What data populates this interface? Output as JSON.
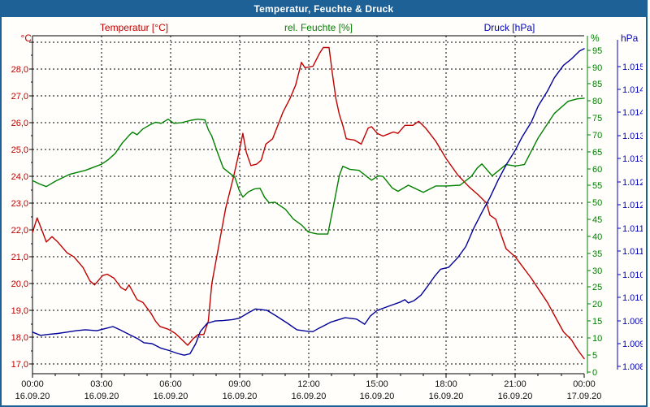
{
  "window": {
    "title": "Temperatur, Feuchte & Druck",
    "title_bar_color": "#1d6197",
    "border_color": "#1d6197",
    "background": "#fffefa"
  },
  "legend": {
    "temperature": "Temperatur [°C]",
    "humidity": "rel. Feuchte [%]",
    "pressure": "Druck [hPa]"
  },
  "chart_data": {
    "type": "line",
    "title": "Temperatur, Feuchte & Druck",
    "grid": true,
    "axes": {
      "x": {
        "min": 0,
        "max": 24,
        "grid_hours": [
          3,
          6,
          9,
          12,
          15,
          18,
          21
        ],
        "ticks": [
          {
            "hour": 0,
            "time": "00:00",
            "date": "16.09.20"
          },
          {
            "hour": 3,
            "time": "03:00",
            "date": "16.09.20"
          },
          {
            "hour": 6,
            "time": "06:00",
            "date": "16.09.20"
          },
          {
            "hour": 9,
            "time": "09:00",
            "date": "16.09.20"
          },
          {
            "hour": 12,
            "time": "12:00",
            "date": "16.09.20"
          },
          {
            "hour": 15,
            "time": "15:00",
            "date": "16.09.20"
          },
          {
            "hour": 18,
            "time": "18:00",
            "date": "16.09.20"
          },
          {
            "hour": 21,
            "time": "21:00",
            "date": "16.09.20"
          },
          {
            "hour": 24,
            "time": "00:00",
            "date": "17.09.20"
          }
        ]
      },
      "temperature": {
        "unit": "°C",
        "color": "#c00000",
        "min": 16.64,
        "max": 29.24,
        "tick_values": [
          28,
          27,
          26,
          25,
          24,
          23,
          22,
          21,
          20,
          19,
          18,
          17
        ],
        "tick_labels": [
          "28,0",
          "27,0",
          "26,0",
          "25,0",
          "24,0",
          "23,0",
          "22,0",
          "21,0",
          "20,0",
          "19,0",
          "18,0",
          "17,0"
        ],
        "minor_values": [
          28.5,
          27.5,
          26.5,
          25.5,
          24.5,
          23.5,
          22.5,
          21.5,
          20.5,
          19.5,
          18.5,
          17.5
        ],
        "grid_values": [
          29,
          28,
          27,
          26,
          25,
          24,
          23,
          22,
          21,
          20,
          19,
          18,
          17
        ]
      },
      "humidity": {
        "unit": "%",
        "color": "#008000",
        "min": -0.55,
        "max": 99.25,
        "tick_values": [
          95,
          90,
          85,
          80,
          75,
          70,
          65,
          60,
          55,
          50,
          45,
          40,
          35,
          30,
          25,
          20,
          15,
          10,
          5,
          0
        ],
        "tick_labels": [
          "95",
          "90",
          "85",
          "80",
          "75",
          "70",
          "65",
          "60",
          "55",
          "50",
          "45",
          "40",
          "35",
          "30",
          "25",
          "20",
          "15",
          "10",
          "5",
          "0"
        ]
      },
      "pressure": {
        "unit": "hPa",
        "color": "#0000bb",
        "min": 1008.35,
        "max": 1015.66,
        "tick_values": [
          1015,
          1014.5,
          1014,
          1013.5,
          1013,
          1012.5,
          1012,
          1011.5,
          1011,
          1010.5,
          1010,
          1009.5,
          1009,
          1008.5
        ],
        "tick_labels": [
          "1.015",
          "1.014",
          "1.014",
          "1.013",
          "1.013",
          "1.012",
          "1.012",
          "1.011",
          "1.011",
          "1.010",
          "1.010",
          "1.009",
          "1.009",
          "1.008"
        ]
      }
    },
    "series": [
      {
        "name": "temperature",
        "label": "Temperatur [°C]",
        "axis": "temperature",
        "color": "#bf0000",
        "points": [
          [
            0,
            21.9
          ],
          [
            0.2,
            22.45
          ],
          [
            0.45,
            21.9
          ],
          [
            0.6,
            21.55
          ],
          [
            0.85,
            21.75
          ],
          [
            1.1,
            21.55
          ],
          [
            1.5,
            21.15
          ],
          [
            1.8,
            21.0
          ],
          [
            2.2,
            20.6
          ],
          [
            2.5,
            20.1
          ],
          [
            2.7,
            19.95
          ],
          [
            3.05,
            20.3
          ],
          [
            3.25,
            20.35
          ],
          [
            3.55,
            20.2
          ],
          [
            3.85,
            19.85
          ],
          [
            4.05,
            19.75
          ],
          [
            4.2,
            19.95
          ],
          [
            4.55,
            19.4
          ],
          [
            4.8,
            19.3
          ],
          [
            5.15,
            18.9
          ],
          [
            5.35,
            18.6
          ],
          [
            5.55,
            18.4
          ],
          [
            5.9,
            18.3
          ],
          [
            6.2,
            18.15
          ],
          [
            6.45,
            17.95
          ],
          [
            6.75,
            17.7
          ],
          [
            7.0,
            17.95
          ],
          [
            7.2,
            18.1
          ],
          [
            7.45,
            18.1
          ],
          [
            7.65,
            18.6
          ],
          [
            7.8,
            20.0
          ],
          [
            8.1,
            21.4
          ],
          [
            8.4,
            22.8
          ],
          [
            8.75,
            24.0
          ],
          [
            8.95,
            24.75
          ],
          [
            9.15,
            25.6
          ],
          [
            9.3,
            24.9
          ],
          [
            9.5,
            24.4
          ],
          [
            9.75,
            24.45
          ],
          [
            9.95,
            24.6
          ],
          [
            10.15,
            25.2
          ],
          [
            10.45,
            25.4
          ],
          [
            10.9,
            26.4
          ],
          [
            11.2,
            26.9
          ],
          [
            11.45,
            27.4
          ],
          [
            11.7,
            28.25
          ],
          [
            11.85,
            28.05
          ],
          [
            12.2,
            28.1
          ],
          [
            12.5,
            28.6
          ],
          [
            12.65,
            28.8
          ],
          [
            12.9,
            28.8
          ],
          [
            13.05,
            27.8
          ],
          [
            13.2,
            26.9
          ],
          [
            13.35,
            26.3
          ],
          [
            13.5,
            25.9
          ],
          [
            13.65,
            25.4
          ],
          [
            14.0,
            25.35
          ],
          [
            14.3,
            25.2
          ],
          [
            14.6,
            25.8
          ],
          [
            14.75,
            25.85
          ],
          [
            15.0,
            25.6
          ],
          [
            15.25,
            25.5
          ],
          [
            15.55,
            25.6
          ],
          [
            15.7,
            25.65
          ],
          [
            15.9,
            25.6
          ],
          [
            16.2,
            25.9
          ],
          [
            16.55,
            25.9
          ],
          [
            16.8,
            26.05
          ],
          [
            17.1,
            25.8
          ],
          [
            17.55,
            25.3
          ],
          [
            18.0,
            24.65
          ],
          [
            18.5,
            24.05
          ],
          [
            19.0,
            23.6
          ],
          [
            19.4,
            23.3
          ],
          [
            19.75,
            23.0
          ],
          [
            19.9,
            22.55
          ],
          [
            20.15,
            22.4
          ],
          [
            20.6,
            21.3
          ],
          [
            21.0,
            21.0
          ],
          [
            21.7,
            20.2
          ],
          [
            22.4,
            19.3
          ],
          [
            23.1,
            18.2
          ],
          [
            23.45,
            17.9
          ],
          [
            23.7,
            17.55
          ],
          [
            24,
            17.2
          ]
        ]
      },
      {
        "name": "humidity",
        "label": "rel. Feuchte [%]",
        "axis": "humidity",
        "color": "#008000",
        "points": [
          [
            0,
            56.5
          ],
          [
            0.3,
            55.5
          ],
          [
            0.6,
            54.7
          ],
          [
            1.0,
            56.3
          ],
          [
            1.6,
            58.3
          ],
          [
            2.3,
            59.5
          ],
          [
            3.0,
            61.3
          ],
          [
            3.3,
            62.7
          ],
          [
            3.6,
            64.5
          ],
          [
            3.9,
            67.5
          ],
          [
            4.2,
            69.8
          ],
          [
            4.35,
            70.8
          ],
          [
            4.55,
            70.0
          ],
          [
            4.8,
            71.7
          ],
          [
            5.1,
            72.9
          ],
          [
            5.35,
            73.7
          ],
          [
            5.6,
            73.4
          ],
          [
            5.9,
            74.6
          ],
          [
            6.15,
            73.4
          ],
          [
            6.5,
            73.6
          ],
          [
            6.9,
            74.3
          ],
          [
            7.2,
            74.6
          ],
          [
            7.5,
            74.4
          ],
          [
            7.65,
            71.5
          ],
          [
            7.8,
            69.6
          ],
          [
            8.05,
            64.8
          ],
          [
            8.3,
            60.2
          ],
          [
            8.55,
            58.8
          ],
          [
            8.8,
            57.5
          ],
          [
            9.0,
            53.5
          ],
          [
            9.15,
            51.6
          ],
          [
            9.4,
            53.2
          ],
          [
            9.65,
            54.0
          ],
          [
            9.9,
            54.2
          ],
          [
            10.1,
            51.5
          ],
          [
            10.3,
            49.9
          ],
          [
            10.55,
            50.1
          ],
          [
            11.0,
            48.0
          ],
          [
            11.35,
            45.1
          ],
          [
            11.7,
            43.4
          ],
          [
            12.0,
            41.3
          ],
          [
            12.4,
            40.7
          ],
          [
            12.85,
            40.7
          ],
          [
            13.1,
            49.2
          ],
          [
            13.35,
            58.0
          ],
          [
            13.5,
            60.7
          ],
          [
            13.8,
            59.8
          ],
          [
            14.2,
            59.5
          ],
          [
            14.75,
            56.6
          ],
          [
            15.05,
            57.9
          ],
          [
            15.25,
            57.7
          ],
          [
            15.65,
            54.3
          ],
          [
            15.9,
            53.3
          ],
          [
            16.35,
            55.1
          ],
          [
            17.0,
            53.0
          ],
          [
            17.55,
            54.9
          ],
          [
            18.0,
            54.9
          ],
          [
            18.6,
            55.1
          ],
          [
            19.1,
            57.8
          ],
          [
            19.35,
            60.2
          ],
          [
            19.55,
            61.4
          ],
          [
            20.0,
            57.9
          ],
          [
            20.6,
            61.2
          ],
          [
            21.0,
            60.8
          ],
          [
            21.4,
            61.2
          ],
          [
            22.0,
            69.1
          ],
          [
            22.7,
            76.3
          ],
          [
            23.3,
            79.9
          ],
          [
            23.7,
            80.6
          ],
          [
            24,
            80.8
          ]
        ]
      },
      {
        "name": "pressure",
        "label": "Druck [hPa]",
        "axis": "pressure",
        "color": "#000099",
        "points": [
          [
            0,
            1009.25
          ],
          [
            0.35,
            1009.18
          ],
          [
            0.7,
            1009.2
          ],
          [
            1.1,
            1009.22
          ],
          [
            1.5,
            1009.25
          ],
          [
            1.9,
            1009.28
          ],
          [
            2.3,
            1009.3
          ],
          [
            2.8,
            1009.28
          ],
          [
            3.2,
            1009.33
          ],
          [
            3.5,
            1009.37
          ],
          [
            3.8,
            1009.3
          ],
          [
            4.2,
            1009.2
          ],
          [
            4.6,
            1009.1
          ],
          [
            4.85,
            1009.02
          ],
          [
            5.2,
            1009.0
          ],
          [
            5.6,
            1008.9
          ],
          [
            5.95,
            1008.85
          ],
          [
            6.3,
            1008.79
          ],
          [
            6.6,
            1008.75
          ],
          [
            6.85,
            1008.78
          ],
          [
            7.1,
            1009.0
          ],
          [
            7.3,
            1009.26
          ],
          [
            7.6,
            1009.44
          ],
          [
            7.95,
            1009.49
          ],
          [
            8.3,
            1009.5
          ],
          [
            8.7,
            1009.52
          ],
          [
            9.0,
            1009.55
          ],
          [
            9.4,
            1009.67
          ],
          [
            9.7,
            1009.75
          ],
          [
            10.2,
            1009.72
          ],
          [
            10.6,
            1009.6
          ],
          [
            11.1,
            1009.44
          ],
          [
            11.5,
            1009.3
          ],
          [
            11.9,
            1009.27
          ],
          [
            12.2,
            1009.26
          ],
          [
            12.45,
            1009.33
          ],
          [
            13.0,
            1009.47
          ],
          [
            13.6,
            1009.56
          ],
          [
            14.1,
            1009.53
          ],
          [
            14.45,
            1009.42
          ],
          [
            14.7,
            1009.6
          ],
          [
            15.0,
            1009.72
          ],
          [
            15.5,
            1009.81
          ],
          [
            16.0,
            1009.9
          ],
          [
            16.2,
            1009.95
          ],
          [
            16.35,
            1009.88
          ],
          [
            16.6,
            1009.93
          ],
          [
            16.9,
            1010.05
          ],
          [
            17.2,
            1010.25
          ],
          [
            17.5,
            1010.46
          ],
          [
            17.75,
            1010.61
          ],
          [
            18.1,
            1010.65
          ],
          [
            18.5,
            1010.86
          ],
          [
            18.85,
            1011.1
          ],
          [
            19.2,
            1011.5
          ],
          [
            19.55,
            1011.84
          ],
          [
            19.9,
            1012.16
          ],
          [
            20.25,
            1012.53
          ],
          [
            20.6,
            1012.86
          ],
          [
            21.0,
            1013.18
          ],
          [
            21.3,
            1013.47
          ],
          [
            21.7,
            1013.79
          ],
          [
            22.0,
            1014.14
          ],
          [
            22.4,
            1014.46
          ],
          [
            22.7,
            1014.75
          ],
          [
            23.1,
            1015.02
          ],
          [
            23.45,
            1015.16
          ],
          [
            23.8,
            1015.33
          ],
          [
            24,
            1015.38
          ]
        ]
      }
    ]
  }
}
